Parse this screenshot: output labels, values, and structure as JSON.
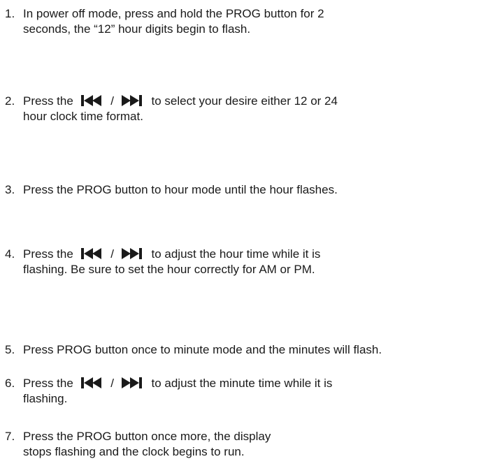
{
  "steps": [
    {
      "number": "1.",
      "line1": "In power off mode, press and hold the PROG button for 2",
      "line2": "seconds, the “12” hour digits begin to flash."
    },
    {
      "number": "2.",
      "pre": "Press the",
      "sep": "/",
      "post": "to select your desire either 12 or 24",
      "line2": "hour clock time format."
    },
    {
      "number": "3.",
      "line1": "Press the PROG button to hour mode until the hour flashes."
    },
    {
      "number": "4.",
      "pre": "Press the",
      "sep": "/",
      "post": "to adjust the hour time while it is",
      "line2": "flashing. Be sure to set the hour correctly for AM or PM."
    },
    {
      "number": "5.",
      "line1": "Press PROG button once to minute mode and the minutes will flash."
    },
    {
      "number": "6.",
      "pre": "Press the",
      "sep": "/",
      "post": "to adjust the minute time while it is",
      "line2": "flashing."
    },
    {
      "number": "7.",
      "line1": "Press the PROG button once more, the display",
      "line2": "stops flashing and the clock begins to run."
    }
  ],
  "icons": {
    "previous": "skip-previous-icon",
    "next": "skip-next-icon"
  }
}
